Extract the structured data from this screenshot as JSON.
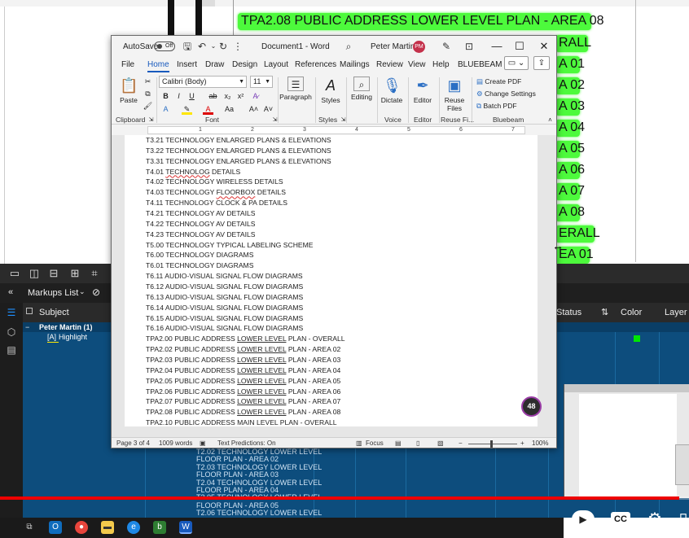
{
  "background": {
    "drawing_title": "TPA2.08     PUBLIC ADDRESS LOWER LEVEL PLAN - AREA 08",
    "drawing_labels": [
      "RALL",
      "A 01",
      "A 02",
      "A 03",
      "A 04",
      "A 05",
      "A 06",
      "A 07",
      "A 08",
      "ERALL",
      "EA 01"
    ],
    "highlight_color": "#4dfa3c"
  },
  "bluebeam": {
    "markups_title": "Markups List",
    "columns": {
      "subject": "Subject",
      "status": "Status",
      "color": "Color",
      "layer": "Layer"
    },
    "group_row": "Peter Martin (1)",
    "markup_row": {
      "icon": "[A]",
      "label": "Highlight",
      "color": "#00e600"
    },
    "subject_lines": [
      "T2.02 TECHNOLOGY LOWER LEVEL",
      "FLOOR PLAN - AREA 02",
      "T2.03 TECHNOLOGY LOWER LEVEL",
      "FLOOR PLAN - AREA 03",
      "T2.04 TECHNOLOGY LOWER LEVEL",
      "FLOOR PLAN - AREA 04",
      "T2.05 TECHNOLOGY LOWER LEVEL",
      "FLOOR PLAN - AREA 05",
      "T2.06 TECHNOLOGY LOWER LEVEL"
    ]
  },
  "word": {
    "autosave_label": "AutoSave",
    "autosave_state": "Off",
    "doc_title": "Document1  -  Word",
    "user_name": "Peter Martin",
    "user_initials": "PM",
    "menu_tabs": [
      "File",
      "Home",
      "Insert",
      "Draw",
      "Design",
      "Layout",
      "References",
      "Mailings",
      "Review",
      "View",
      "Help",
      "BLUEBEAM"
    ],
    "active_tab": "Home",
    "ribbon": {
      "paste": "Paste",
      "font_name": "Calibri (Body)",
      "font_size": "11",
      "paragraph": "Paragraph",
      "styles": "Styles",
      "editing": "Editing",
      "dictate": "Dictate",
      "editor": "Editor",
      "reuse_files": "Reuse Files",
      "create_pdf": "Create PDF",
      "change_settings": "Change Settings",
      "batch_pdf": "Batch PDF",
      "groups": {
        "clipboard": "Clipboard",
        "font": "Font",
        "styles": "Styles",
        "voice": "Voice",
        "editor": "Editor",
        "reuse": "Reuse Fi...",
        "bluebeam": "Bluebeam"
      }
    },
    "ruler_numbers": [
      "1",
      "2",
      "3",
      "4",
      "5",
      "6",
      "7"
    ],
    "lines": [
      "T3.21 TECHNOLOGY ENLARGED PLANS & ELEVATIONS",
      "T3.22 TECHNOLOGY ENLARGED PLANS & ELEVATIONS",
      "T3.31 TECHNOLOGY ENLARGED PLANS & ELEVATIONS",
      "T4.01 TECHNOLOG DETAILS",
      "T4.02 TECHNOLOGY WIRELESS DETAILS",
      "T4.03 TECHNOLOGY FLOORBOX DETAILS",
      "T4.11 TECHNOLOGY CLOCK & PA DETAILS",
      "T4.21 TECHNOLOGY AV DETAILS",
      "T4.22 TECHNOLOGY AV DETAILS",
      "T4.23 TECHNOLOGY AV DETAILS",
      "T5.00 TECHNOLOGY TYPICAL LABELING SCHEME",
      "T6.00 TECHNOLOGY DIAGRAMS",
      "T6.01 TECHNOLOGY DIAGRAMS",
      "T6.11 AUDIO-VISUAL SIGNAL FLOW DIAGRAMS",
      "T6.12 AUDIO-VISUAL SIGNAL FLOW DIAGRAMS",
      "T6.13 AUDIO-VISUAL SIGNAL FLOW DIAGRAMS",
      "T6.14 AUDIO-VISUAL SIGNAL FLOW DIAGRAMS",
      "T6.15 AUDIO-VISUAL SIGNAL FLOW DIAGRAMS",
      "T6.16 AUDIO-VISUAL SIGNAL FLOW DIAGRAMS",
      "TPA2.00 PUBLIC ADDRESS LOWER LEVEL PLAN - OVERALL",
      "TPA2.02 PUBLIC ADDRESS LOWER LEVEL PLAN - AREA 02",
      "TPA2.03 PUBLIC ADDRESS LOWER LEVEL PLAN - AREA 03",
      "TPA2.04 PUBLIC ADDRESS LOWER LEVEL PLAN - AREA 04",
      "TPA2.05 PUBLIC ADDRESS LOWER LEVEL PLAN - AREA 05",
      "TPA2.06 PUBLIC ADDRESS LOWER LEVEL PLAN - AREA 06",
      "TPA2.07 PUBLIC ADDRESS LOWER LEVEL PLAN - AREA 07",
      "TPA2.08 PUBLIC ADDRESS LOWER LEVEL PLAN - AREA 08",
      "TPA2.10 PUBLIC ADDRESS MAIN LEVEL PLAN - OVERALL"
    ],
    "page_badge": "48",
    "status": {
      "page": "Page 3 of 4",
      "words": "1009 words",
      "predictions": "Text Predictions: On",
      "focus": "Focus",
      "zoom": "100%"
    }
  }
}
